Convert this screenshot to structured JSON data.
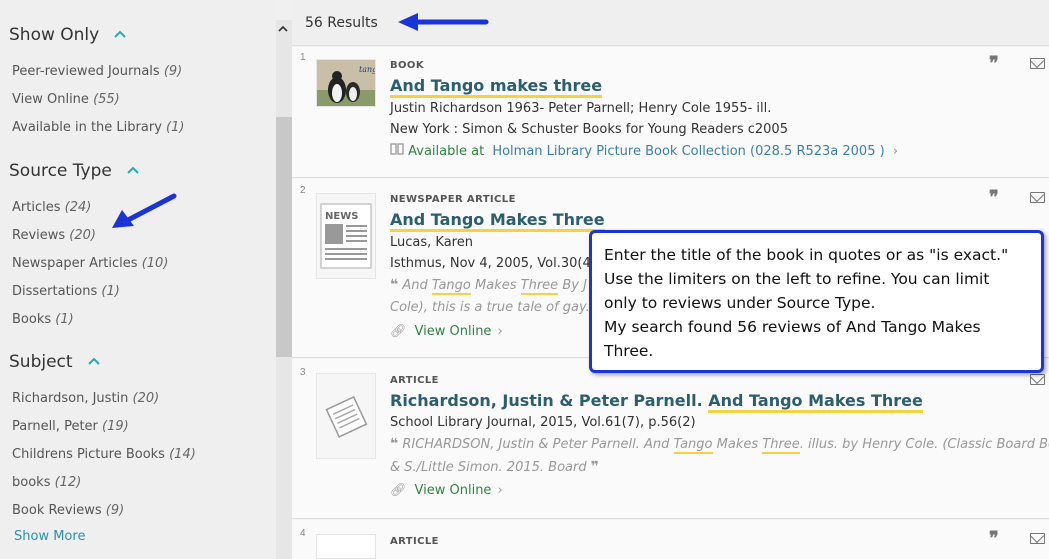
{
  "sidebar": {
    "show_only": {
      "heading": "Show Only",
      "items": [
        {
          "label": "Peer-reviewed Journals",
          "count": "(9)"
        },
        {
          "label": "View Online",
          "count": "(55)"
        },
        {
          "label": "Available in the Library",
          "count": "(1)"
        }
      ]
    },
    "source_type": {
      "heading": "Source Type",
      "items": [
        {
          "label": "Articles",
          "count": "(24)"
        },
        {
          "label": "Reviews",
          "count": "(20)"
        },
        {
          "label": "Newspaper Articles",
          "count": "(10)"
        },
        {
          "label": "Dissertations",
          "count": "(1)"
        },
        {
          "label": "Books",
          "count": "(1)"
        }
      ]
    },
    "subject": {
      "heading": "Subject",
      "items": [
        {
          "label": "Richardson, Justin",
          "count": "(20)"
        },
        {
          "label": "Parnell, Peter",
          "count": "(19)"
        },
        {
          "label": "Childrens Picture Books",
          "count": "(14)"
        },
        {
          "label": "books",
          "count": "(12)"
        },
        {
          "label": "Book Reviews",
          "count": "(9)"
        }
      ],
      "show_more": "Show More"
    }
  },
  "results": {
    "count_label": "56 Results",
    "items": [
      {
        "num": "1",
        "type": "BOOK",
        "title": "And Tango makes three",
        "authors": "Justin Richardson 1963- Peter Parnell; Henry Cole 1955- ill.",
        "publisher": "New York : Simon & Schuster Books for Young Readers c2005",
        "available_label": "Available at",
        "location": "Holman Library Picture Book Collection (028.5 R523a 2005 )",
        "thumb_label": "tango"
      },
      {
        "num": "2",
        "type": "NEWSPAPER ARTICLE",
        "title": "And Tango Makes Three",
        "author": "Lucas, Karen",
        "source": "Isthmus, Nov 4, 2005, Vol.30(44)",
        "snippet_a": "And",
        "snippet_hl": "Tango",
        "snippet_b": "Makes",
        "snippet_hl2": "Three",
        "snippet_c": "By J",
        "snippet_line2": "Cole), this is a true tale of gay...",
        "view_online": "View Online",
        "thumb_label": "NEWS"
      },
      {
        "num": "3",
        "type": "ARTICLE",
        "title_a": "Richardson, Justin & Peter Parnell.",
        "title_b": "And Tango Makes Three",
        "source": "School Library Journal, 2015, Vol.61(7), p.56(2)",
        "snippet_a": "RICHARDSON, Justin & Peter Parnell. And",
        "snippet_hl": "Tango",
        "snippet_b": "Makes",
        "snippet_hl2": "Three",
        "snippet_c": ". illus. by Henry Cole. (Classic Board Books).",
        "snippet_line2": "& S./Little Simon. 2015. Board",
        "view_online": "View Online"
      },
      {
        "num": "4",
        "type": "ARTICLE"
      }
    ]
  },
  "callout": {
    "text": "Enter the title of the book in quotes or as \"is exact.\"\nUse the limiters on the left to refine. You can limit\nonly to reviews under Source Type.\nMy search found 56 reviews of And Tango Makes\nThree."
  },
  "colors": {
    "accent_teal": "#27a9b3",
    "title_color": "#2b5e6e",
    "highlight_yellow": "#f5d33f",
    "available_green": "#2e8540",
    "annotation_blue": "#1a34d8"
  }
}
